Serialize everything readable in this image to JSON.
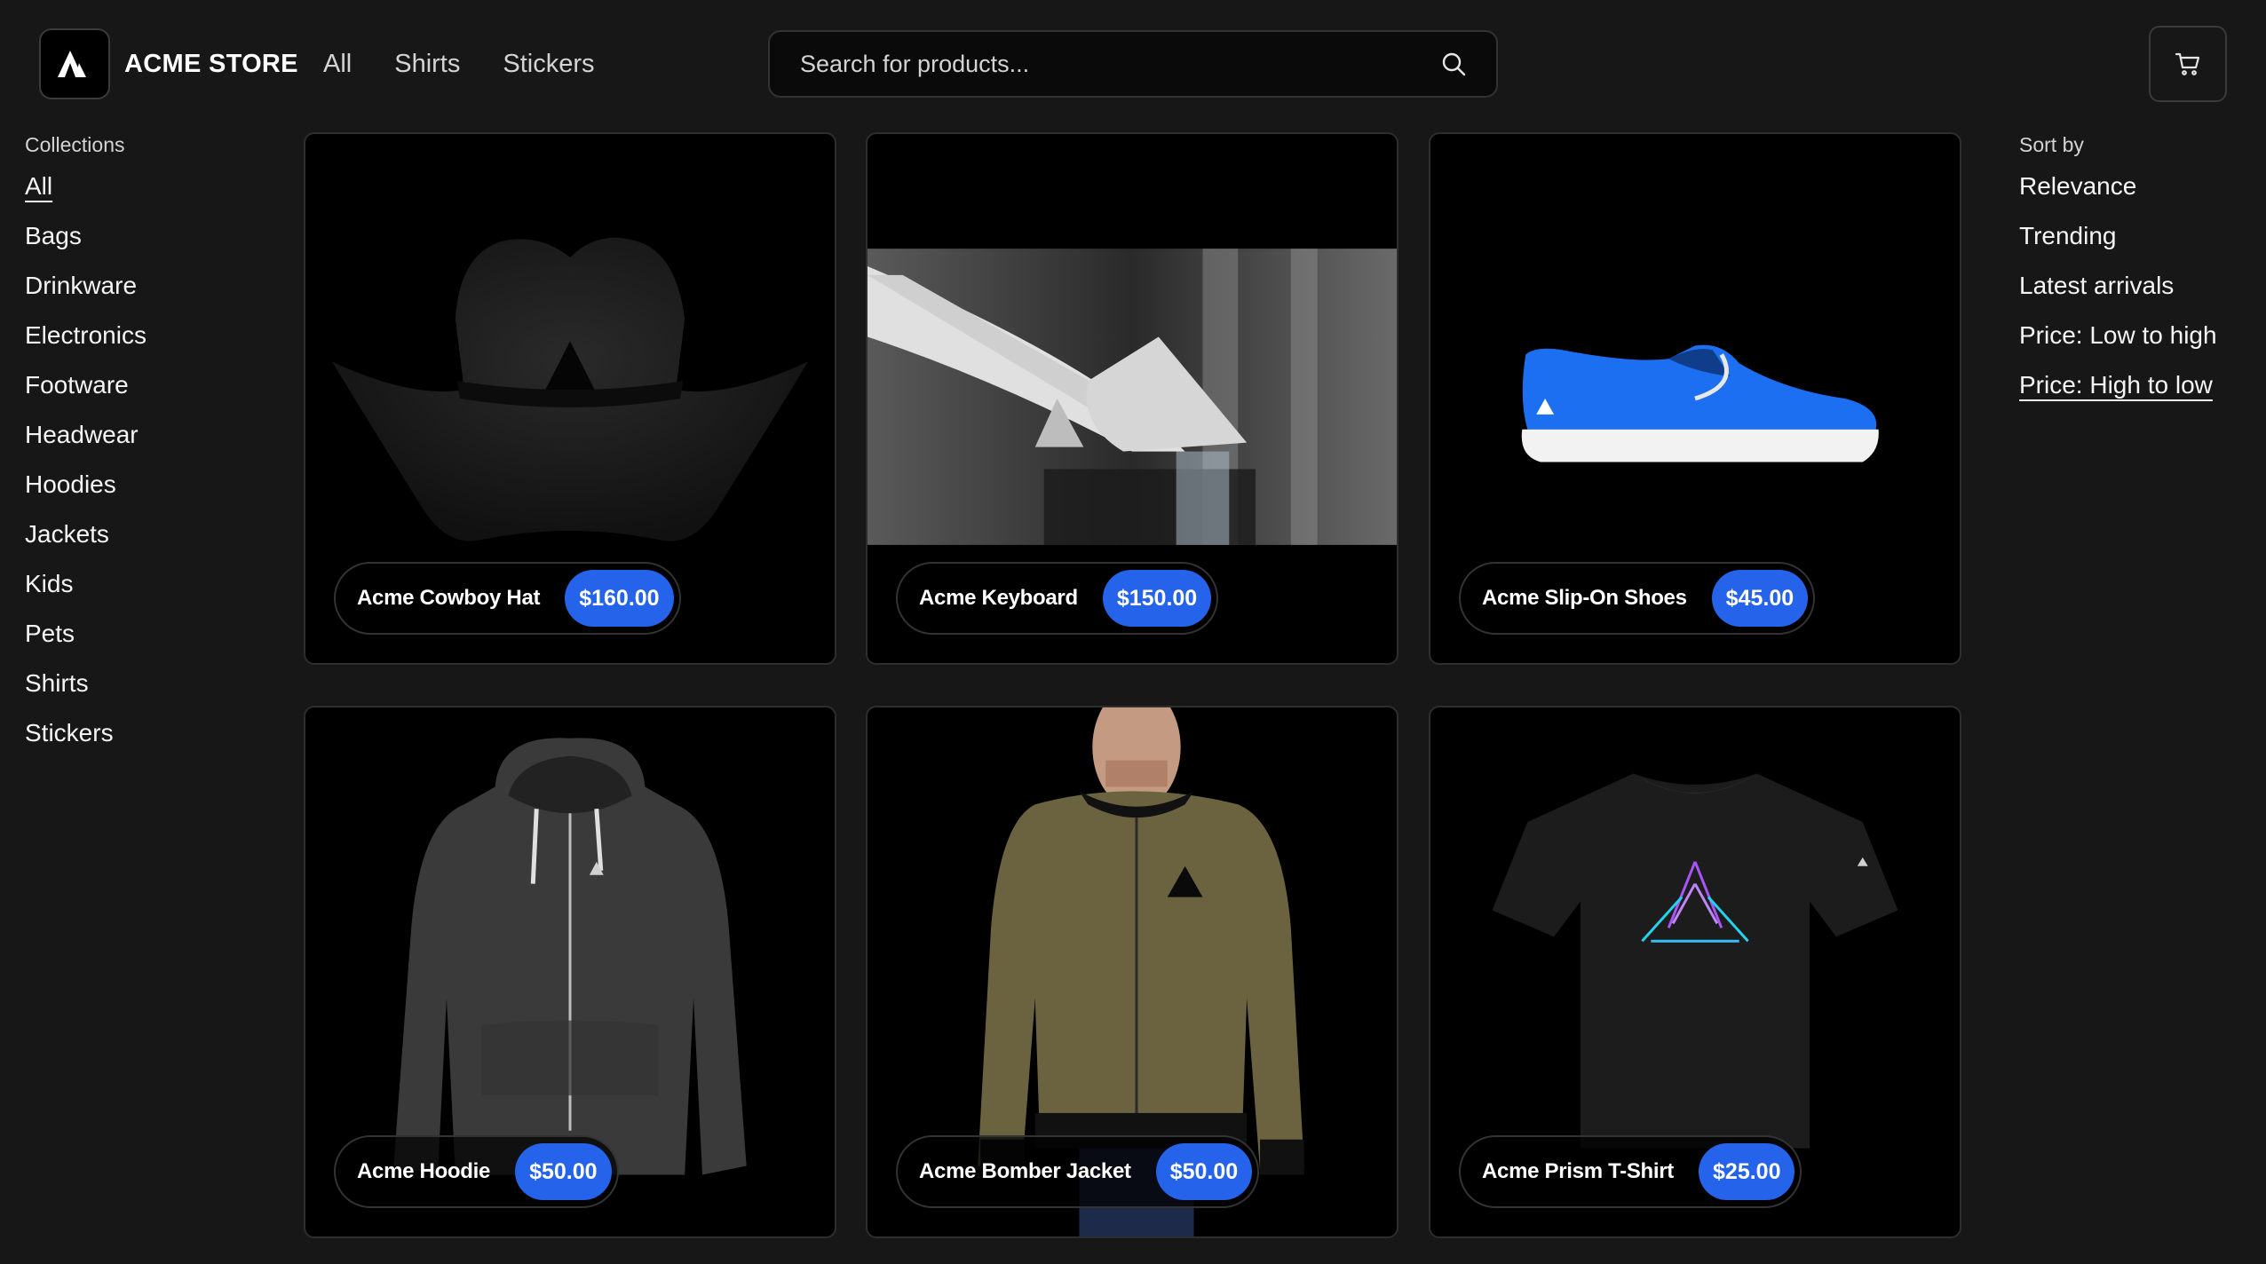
{
  "header": {
    "store_name": "ACME STORE",
    "nav": [
      "All",
      "Shirts",
      "Stickers"
    ],
    "search_placeholder": "Search for products..."
  },
  "collections": {
    "title": "Collections",
    "items": [
      "All",
      "Bags",
      "Drinkware",
      "Electronics",
      "Footware",
      "Headwear",
      "Hoodies",
      "Jackets",
      "Kids",
      "Pets",
      "Shirts",
      "Stickers"
    ],
    "active": "All"
  },
  "sort": {
    "title": "Sort by",
    "items": [
      "Relevance",
      "Trending",
      "Latest arrivals",
      "Price: Low to high",
      "Price: High to low"
    ],
    "active": "Price: High to low"
  },
  "products": [
    {
      "name": "Acme Cowboy Hat",
      "price": "$160.00"
    },
    {
      "name": "Acme Keyboard",
      "price": "$150.00"
    },
    {
      "name": "Acme Slip-On Shoes",
      "price": "$45.00"
    },
    {
      "name": "Acme Hoodie",
      "price": "$50.00"
    },
    {
      "name": "Acme Bomber Jacket",
      "price": "$50.00"
    },
    {
      "name": "Acme Prism T-Shirt",
      "price": "$25.00"
    }
  ],
  "colors": {
    "background": "#171717",
    "card": "#000000",
    "accent": "#2563eb",
    "shoe": "#1d6ff2",
    "jacket": "#6b6340"
  },
  "icons": {
    "logo": "acme-triangle-logo-icon",
    "search": "search-icon",
    "cart": "shopping-cart-icon"
  }
}
